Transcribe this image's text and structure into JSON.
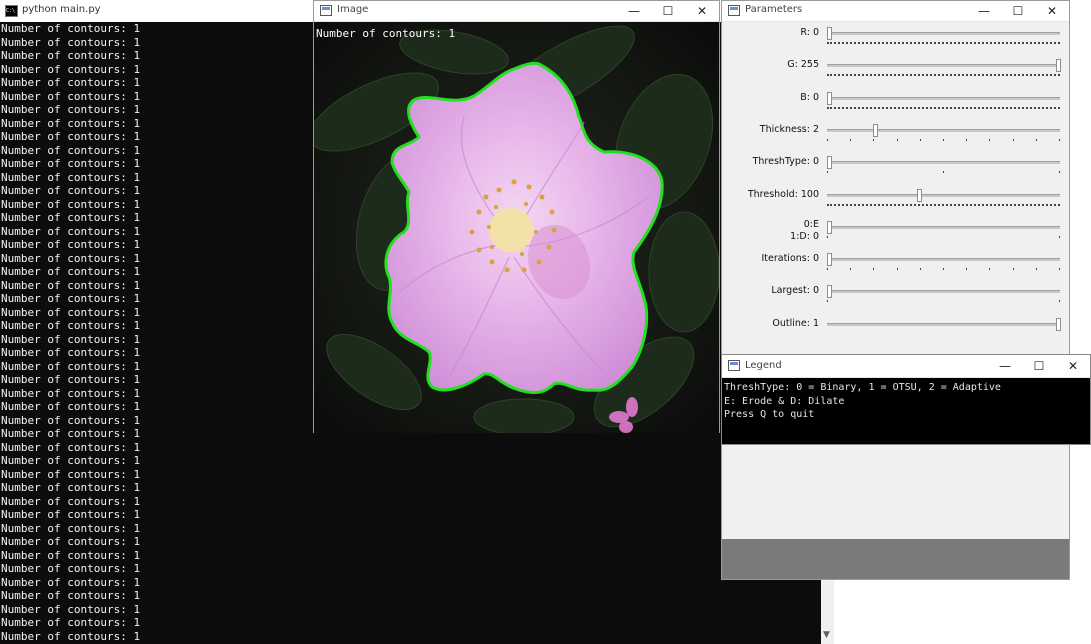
{
  "console": {
    "title": "python  main.py",
    "icon": "cmd-icon",
    "lines": [
      "Number of contours: 1",
      "Number of contours: 1",
      "Number of contours: 1",
      "Number of contours: 1",
      "Number of contours: 1",
      "Number of contours: 1",
      "Number of contours: 1",
      "Number of contours: 1",
      "Number of contours: 1",
      "Number of contours: 1",
      "Number of contours: 1",
      "Number of contours: 1",
      "Number of contours: 1",
      "Number of contours: 1",
      "Number of contours: 1",
      "Number of contours: 1",
      "Number of contours: 1",
      "Number of contours: 1",
      "Number of contours: 1",
      "Number of contours: 1",
      "Number of contours: 1",
      "Number of contours: 1",
      "Number of contours: 1",
      "Number of contours: 1",
      "Number of contours: 1",
      "Number of contours: 1",
      "Number of contours: 1",
      "Number of contours: 1",
      "Number of contours: 1",
      "Number of contours: 1",
      "Number of contours: 1",
      "Number of contours: 1",
      "Number of contours: 1",
      "Number of contours: 1",
      "Number of contours: 1",
      "Number of contours: 1",
      "Number of contours: 1",
      "Number of contours: 1",
      "Number of contours: 1",
      "Number of contours: 1",
      "Number of contours: 1",
      "Number of contours: 1",
      "Number of contours: 1",
      "Number of contours: 1",
      "Number of contours: 1",
      "Number of contours: 1"
    ]
  },
  "image_window": {
    "title": "Image",
    "overlay_text": "Number of contours: 1",
    "contour_color": "#22e01f"
  },
  "params_window": {
    "title": "Parameters",
    "trackbars": [
      {
        "id": "r",
        "label": "R: 0",
        "value": 0,
        "max": 255,
        "ticks": "dense"
      },
      {
        "id": "g",
        "label": "G: 255",
        "value": 255,
        "max": 255,
        "ticks": "dense"
      },
      {
        "id": "b",
        "label": "B: 0",
        "value": 0,
        "max": 255,
        "ticks": "dense"
      },
      {
        "id": "thickness",
        "label": "Thickness: 2",
        "value": 2,
        "max": 10,
        "ticks": 10
      },
      {
        "id": "threshtype",
        "label": "ThreshType: 0",
        "value": 0,
        "max": 2,
        "ticks": 2
      },
      {
        "id": "threshold",
        "label": "Threshold: 100",
        "value": 100,
        "max": 255,
        "ticks": "dense"
      },
      {
        "id": "erode-dilate",
        "label": "0:E\n1:D: 0",
        "value": 0,
        "max": 1,
        "ticks": 1
      },
      {
        "id": "iterations",
        "label": "Iterations: 0",
        "value": 0,
        "max": 10,
        "ticks": 10
      },
      {
        "id": "largest",
        "label": "Largest: 0",
        "value": 0,
        "max": 1,
        "ticks": 1
      },
      {
        "id": "outline",
        "label": "Outline: 1",
        "value": 1,
        "max": 1,
        "ticks": 0
      }
    ]
  },
  "legend_window": {
    "title": "Legend",
    "lines": [
      "ThreshType: 0 = Binary, 1 = OTSU, 2 = Adaptive",
      "E: Erode & D: Dilate",
      "Press Q to quit"
    ]
  },
  "window_buttons": {
    "minimize": "—",
    "maximize": "☐",
    "close": "✕"
  }
}
